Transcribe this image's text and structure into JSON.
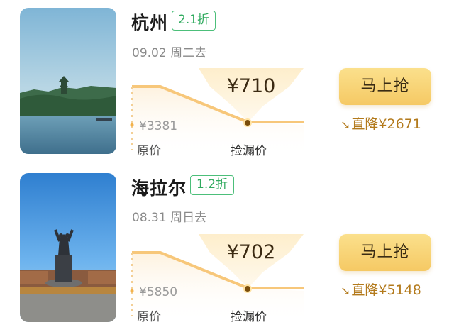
{
  "deals": [
    {
      "city": "杭州",
      "discount": "2.1折",
      "date": "09.02 周二去",
      "deal_price": "¥710",
      "original_price": "¥3381",
      "original_label": "原价",
      "deal_label": "捡漏价",
      "button": "马上抢",
      "drop": "直降¥2671",
      "image_icon": "west-lake-pagoda-photo"
    },
    {
      "city": "海拉尔",
      "discount": "1.2折",
      "date": "08.31 周日去",
      "deal_price": "¥702",
      "original_price": "¥5850",
      "original_label": "原价",
      "deal_label": "捡漏价",
      "button": "马上抢",
      "drop": "直降¥5148",
      "image_icon": "statue-monument-photo"
    }
  ],
  "colors": {
    "accent_gold": "#f5c964",
    "discount_green": "#2faa5e",
    "drop_brown": "#b37a1c"
  }
}
